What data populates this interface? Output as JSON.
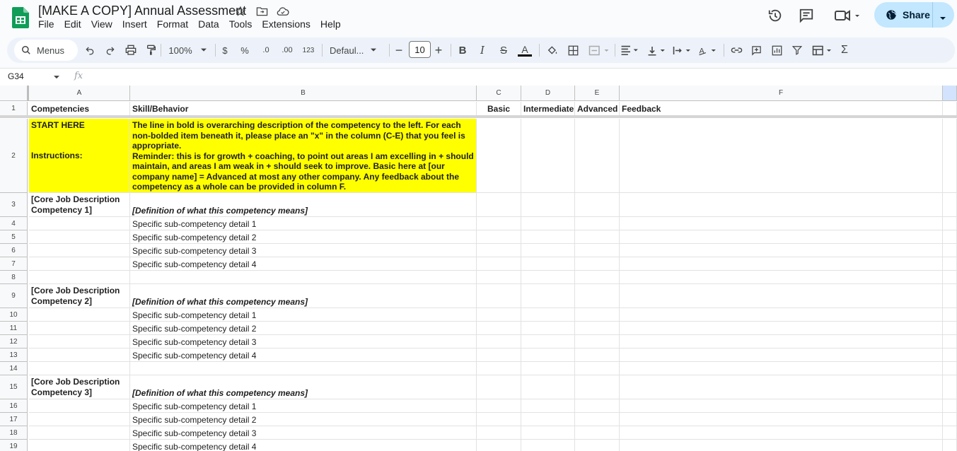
{
  "app": {
    "doc_title": "[MAKE A COPY] Annual Assessment",
    "menus": [
      "File",
      "Edit",
      "View",
      "Insert",
      "Format",
      "Data",
      "Tools",
      "Extensions",
      "Help"
    ],
    "share_label": "Share",
    "accent": "#c2e7ff"
  },
  "toolbar": {
    "menus_label": "Menus",
    "zoom": "100%",
    "currency": "$",
    "percent": "%",
    "dec_decrease": ".0",
    "dec_increase": ".00",
    "number_format": "123",
    "font": "Defaul...",
    "font_size": "10"
  },
  "formula": {
    "name_box": "G34",
    "fx": "fx"
  },
  "columns": [
    "A",
    "B",
    "C",
    "D",
    "E",
    "F"
  ],
  "rows": [
    {
      "n": "1",
      "a": "Competencies",
      "b": "Skill/Behavior",
      "c": "Basic",
      "d": "Intermediate",
      "e": "Advanced",
      "f": "Feedback"
    },
    {
      "n": "2",
      "a1": "START HERE",
      "a2": "Instructions:",
      "b": "The line in bold is overarching description of the competency to the left. For each non-bolded item beneath it, please place an \"x\" in the column (C-E) that you feel is appropriate.\nReminder: this is for growth + coaching, to point out areas I am excelling in + should maintain, and areas I am weak in + should seek to improve. Basic here at [our company name] = Advanced at most any other company. Any feedback about the competency as a whole can be provided in column F."
    },
    {
      "n": "3",
      "a": "[Core Job Description Competency 1]",
      "b": "[Definition of what this competency means]"
    },
    {
      "n": "4",
      "b": "Specific sub-competency detail 1"
    },
    {
      "n": "5",
      "b": "Specific sub-competency detail 2"
    },
    {
      "n": "6",
      "b": "Specific sub-competency detail 3"
    },
    {
      "n": "7",
      "b": "Specific sub-competency detail 4"
    },
    {
      "n": "8"
    },
    {
      "n": "9",
      "a": "[Core Job Description Competency 2]",
      "b": "[Definition of what this competency means]"
    },
    {
      "n": "10",
      "b": "Specific sub-competency detail 1"
    },
    {
      "n": "11",
      "b": "Specific sub-competency detail 2"
    },
    {
      "n": "12",
      "b": "Specific sub-competency detail 3"
    },
    {
      "n": "13",
      "b": "Specific sub-competency detail 4"
    },
    {
      "n": "14"
    },
    {
      "n": "15",
      "a": "[Core Job Description Competency 3]",
      "b": "[Definition of what this competency means]"
    },
    {
      "n": "16",
      "b": "Specific sub-competency detail 1"
    },
    {
      "n": "17",
      "b": "Specific sub-competency detail 2"
    },
    {
      "n": "18",
      "b": "Specific sub-competency detail 3"
    },
    {
      "n": "19",
      "b": "Specific sub-competency detail 4"
    }
  ]
}
